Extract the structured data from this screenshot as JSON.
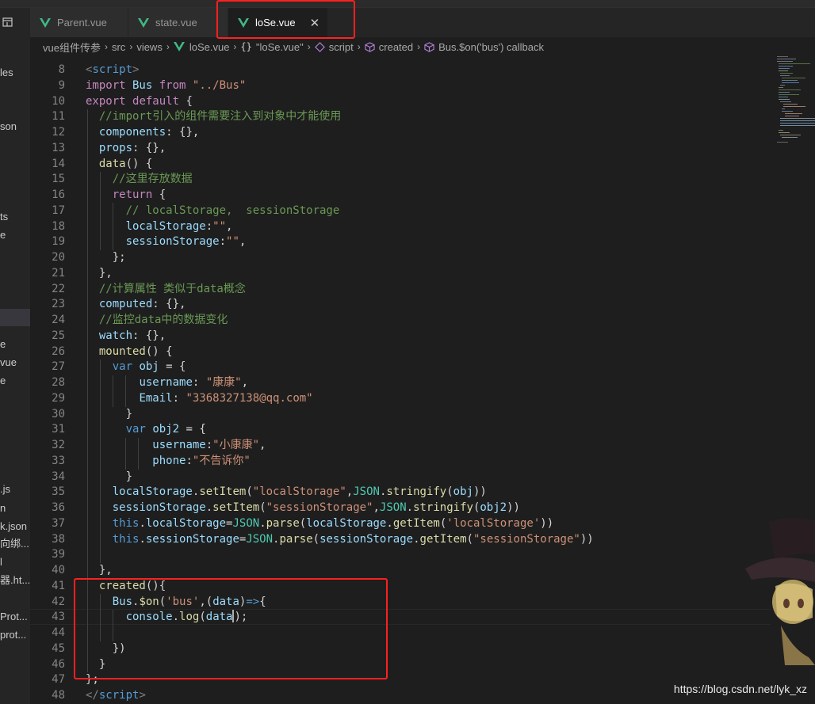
{
  "tabs": [
    {
      "label": "Parent.vue",
      "active": false
    },
    {
      "label": "state.vue",
      "active": false
    },
    {
      "label": "loSe.vue",
      "active": true
    }
  ],
  "tab_close_glyph": "✕",
  "breadcrumb": {
    "project": "vue组件传参",
    "src": "src",
    "views": "views",
    "file": "loSe.vue",
    "obj": "\"loSe.vue\"",
    "script": "script",
    "created": "created",
    "callback": "Bus.$on('bus') callback"
  },
  "sidebar_fragments": [
    {
      "text": "les"
    },
    {
      "text": "son"
    },
    {
      "text": "ts"
    },
    {
      "text": "e"
    },
    {
      "text": "e"
    },
    {
      "text": "vue"
    },
    {
      "text": "e"
    },
    {
      "text": ".js"
    },
    {
      "text": "n"
    },
    {
      "text": "k.json"
    },
    {
      "text": "向绑..."
    },
    {
      "text": "l"
    },
    {
      "text": "器.ht..."
    },
    {
      "text": "Prot..."
    },
    {
      "text": "prot..."
    }
  ],
  "code_lines": [
    {
      "num": "8"
    },
    {
      "num": "9"
    },
    {
      "num": "10"
    },
    {
      "num": "11"
    },
    {
      "num": "12"
    },
    {
      "num": "13"
    },
    {
      "num": "14"
    },
    {
      "num": "15"
    },
    {
      "num": "16"
    },
    {
      "num": "17"
    },
    {
      "num": "18"
    },
    {
      "num": "19"
    },
    {
      "num": "20"
    },
    {
      "num": "21"
    },
    {
      "num": "22"
    },
    {
      "num": "23"
    },
    {
      "num": "24"
    },
    {
      "num": "25"
    },
    {
      "num": "26"
    },
    {
      "num": "27"
    },
    {
      "num": "28"
    },
    {
      "num": "29"
    },
    {
      "num": "30"
    },
    {
      "num": "31"
    },
    {
      "num": "32"
    },
    {
      "num": "33"
    },
    {
      "num": "34"
    },
    {
      "num": "35"
    },
    {
      "num": "36"
    },
    {
      "num": "37"
    },
    {
      "num": "38"
    },
    {
      "num": "39"
    },
    {
      "num": "40"
    },
    {
      "num": "41"
    },
    {
      "num": "42"
    },
    {
      "num": "43"
    },
    {
      "num": "44"
    },
    {
      "num": "45"
    },
    {
      "num": "46"
    },
    {
      "num": "47"
    },
    {
      "num": "48"
    }
  ],
  "code": {
    "l8": [
      "<",
      "script",
      ">"
    ],
    "l9": [
      "import",
      " Bus ",
      "from",
      " ",
      "\"../Bus\""
    ],
    "l10": [
      "export",
      " ",
      "default",
      " {"
    ],
    "l11": [
      "  //import引入的组件需要注入到对象中才能使用"
    ],
    "l12": [
      "  ",
      "components",
      ": {},"
    ],
    "l13": [
      "  ",
      "props",
      ": {},"
    ],
    "l14": [
      "  ",
      "data",
      "() {"
    ],
    "l15": [
      "    //这里存放数据"
    ],
    "l16": [
      "    ",
      "return",
      " {"
    ],
    "l17": [
      "      // localStorage,  sessionStorage"
    ],
    "l18": [
      "      ",
      "localStorage",
      ":",
      "\"\"",
      ","
    ],
    "l19": [
      "      ",
      "sessionStorage",
      ":",
      "\"\"",
      ","
    ],
    "l20": [
      "    };"
    ],
    "l21": [
      "  },"
    ],
    "l22": [
      "  //计算属性 类似于data概念"
    ],
    "l23": [
      "  ",
      "computed",
      ": {},"
    ],
    "l24": [
      "  //监控data中的数据变化"
    ],
    "l25": [
      "  ",
      "watch",
      ": {},"
    ],
    "l26": [
      "  ",
      "mounted",
      "() {"
    ],
    "l27": [
      "    ",
      "var",
      " ",
      "obj",
      " = {"
    ],
    "l28": [
      "        ",
      "username",
      ": ",
      "\"康康\"",
      ","
    ],
    "l29": [
      "        ",
      "Email",
      ": ",
      "\"3368327138@qq.com\""
    ],
    "l30": [
      "      }"
    ],
    "l31": [
      "      ",
      "var",
      " ",
      "obj2",
      " = {"
    ],
    "l32": [
      "          ",
      "username",
      ":",
      "\"小康康\"",
      ","
    ],
    "l33": [
      "          ",
      "phone",
      ":",
      "\"不告诉你\""
    ],
    "l34": [
      "      }"
    ],
    "l35": [
      "    ",
      "localStorage",
      ".",
      "setItem",
      "(",
      "\"localStorage\"",
      ",",
      "JSON",
      ".",
      "stringify",
      "(",
      "obj",
      "))"
    ],
    "l36": [
      "    ",
      "sessionStorage",
      ".",
      "setItem",
      "(",
      "\"sessionStorage\"",
      ",",
      "JSON",
      ".",
      "stringify",
      "(",
      "obj2",
      "))"
    ],
    "l37": [
      "    ",
      "this",
      ".",
      "localStorage",
      "=",
      "JSON",
      ".",
      "parse",
      "(",
      "localStorage",
      ".",
      "getItem",
      "(",
      "'localStorage'",
      "))"
    ],
    "l38": [
      "    ",
      "this",
      ".",
      "sessionStorage",
      "=",
      "JSON",
      ".",
      "parse",
      "(",
      "sessionStorage",
      ".",
      "getItem",
      "(",
      "\"sessionStorage\"",
      "))"
    ],
    "l39": [
      ""
    ],
    "l40": [
      "  },"
    ],
    "l41": [
      "  ",
      "created",
      "(){"
    ],
    "l42": [
      "    ",
      "Bus",
      ".",
      "$on",
      "(",
      "'bus'",
      ",(",
      "data",
      ")",
      "=>",
      "{"
    ],
    "l43": [
      "      ",
      "console",
      ".",
      "log",
      "(",
      "data",
      ")",
      ";"
    ],
    "l44": [
      ""
    ],
    "l45": [
      "    })"
    ],
    "l46": [
      "  }"
    ],
    "l47": [
      "};"
    ],
    "l48": [
      "</",
      "script",
      ">"
    ]
  },
  "watermark": "https://blog.csdn.net/lyk_xz",
  "colors": {
    "accent_red": "#ff2020",
    "vue_green": "#41b883",
    "keyword": "#569cd6",
    "control": "#c586c0",
    "string": "#ce9178",
    "comment": "#6a9955",
    "property": "#9cdcfe",
    "function": "#dcdcaa",
    "class": "#4ec9b0"
  }
}
